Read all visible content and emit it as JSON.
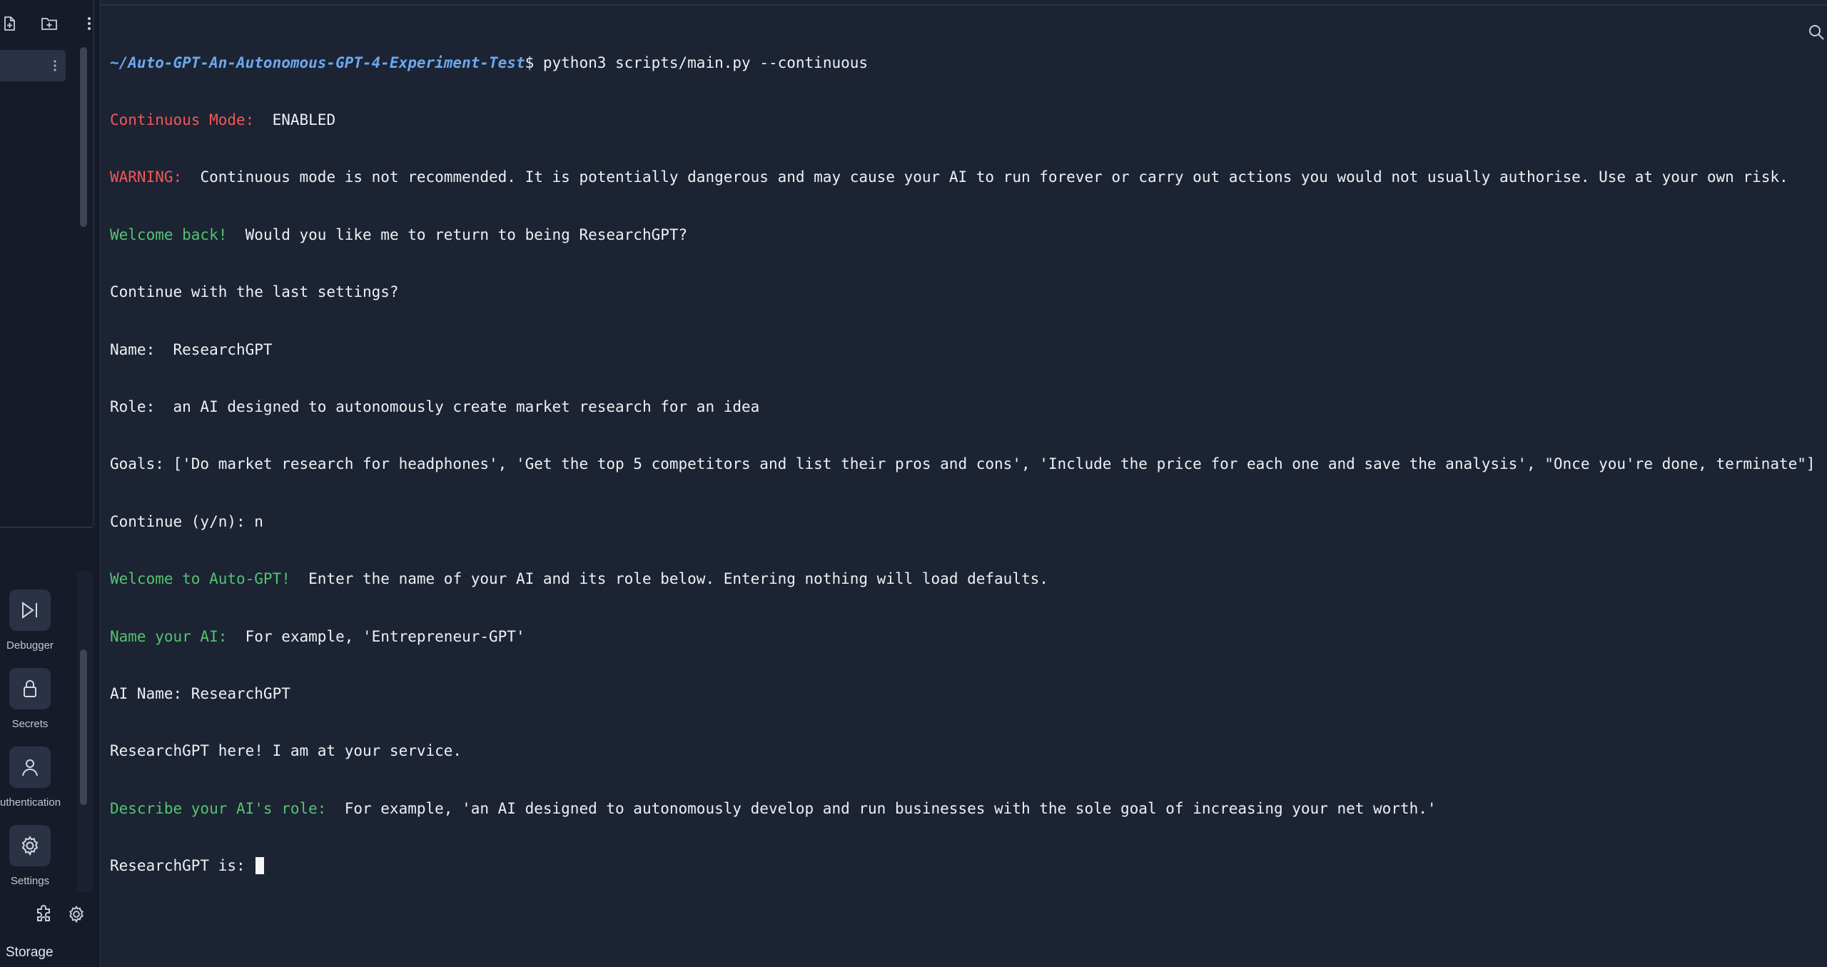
{
  "sidebar": {
    "tools": [
      {
        "label": "Debugger",
        "icon": "debugger-icon"
      },
      {
        "label": "Secrets",
        "icon": "lock-icon"
      },
      {
        "label": "uthentication",
        "icon": "user-icon"
      },
      {
        "label": "Settings",
        "icon": "gear-icon"
      }
    ],
    "storage_label": "Storage"
  },
  "terminal": {
    "prompt_path": "~/Auto-GPT-An-Autonomous-GPT-4-Experiment-Test",
    "command": "$ python3 scripts/main.py --continuous",
    "continuous_label": "Continuous Mode: ",
    "continuous_value": " ENABLED",
    "warning_label": "WARNING: ",
    "warning_text": " Continuous mode is not recommended. It is potentially dangerous and may cause your AI to run forever or carry out actions you would not usually authorise. Use at your own risk.",
    "welcome_back_label": "Welcome back! ",
    "welcome_back_text": " Would you like me to return to being ResearchGPT?",
    "continue_last": "Continue with the last settings?",
    "name_line": "Name:  ResearchGPT",
    "role_line": "Role:  an AI designed to autonomously create market research for an idea",
    "goals_line": "Goals: ['Do market research for headphones', 'Get the top 5 competitors and list their pros and cons', 'Include the price for each one and save the analysis', \"Once you're done, terminate\"]",
    "continue_prompt": "Continue (y/n): n",
    "welcome_label": "Welcome to Auto-GPT! ",
    "welcome_text": " Enter the name of your AI and its role below. Entering nothing will load defaults.",
    "name_ai_label": "Name your AI: ",
    "name_ai_text": " For example, 'Entrepreneur-GPT'",
    "ai_name_line": "AI Name: ResearchGPT",
    "service_line": "ResearchGPT here! I am at your service.",
    "describe_label": "Describe your AI's role: ",
    "describe_text": " For example, 'an AI designed to autonomously develop and run businesses with the sole goal of increasing your net worth.'",
    "input_prompt": "ResearchGPT is: "
  },
  "colors": {
    "background": "#1c2333",
    "sidebar": "#151b29",
    "red": "#f25757",
    "green": "#52c470",
    "path_blue": "#6ca8ee",
    "text": "#eef0f3"
  }
}
